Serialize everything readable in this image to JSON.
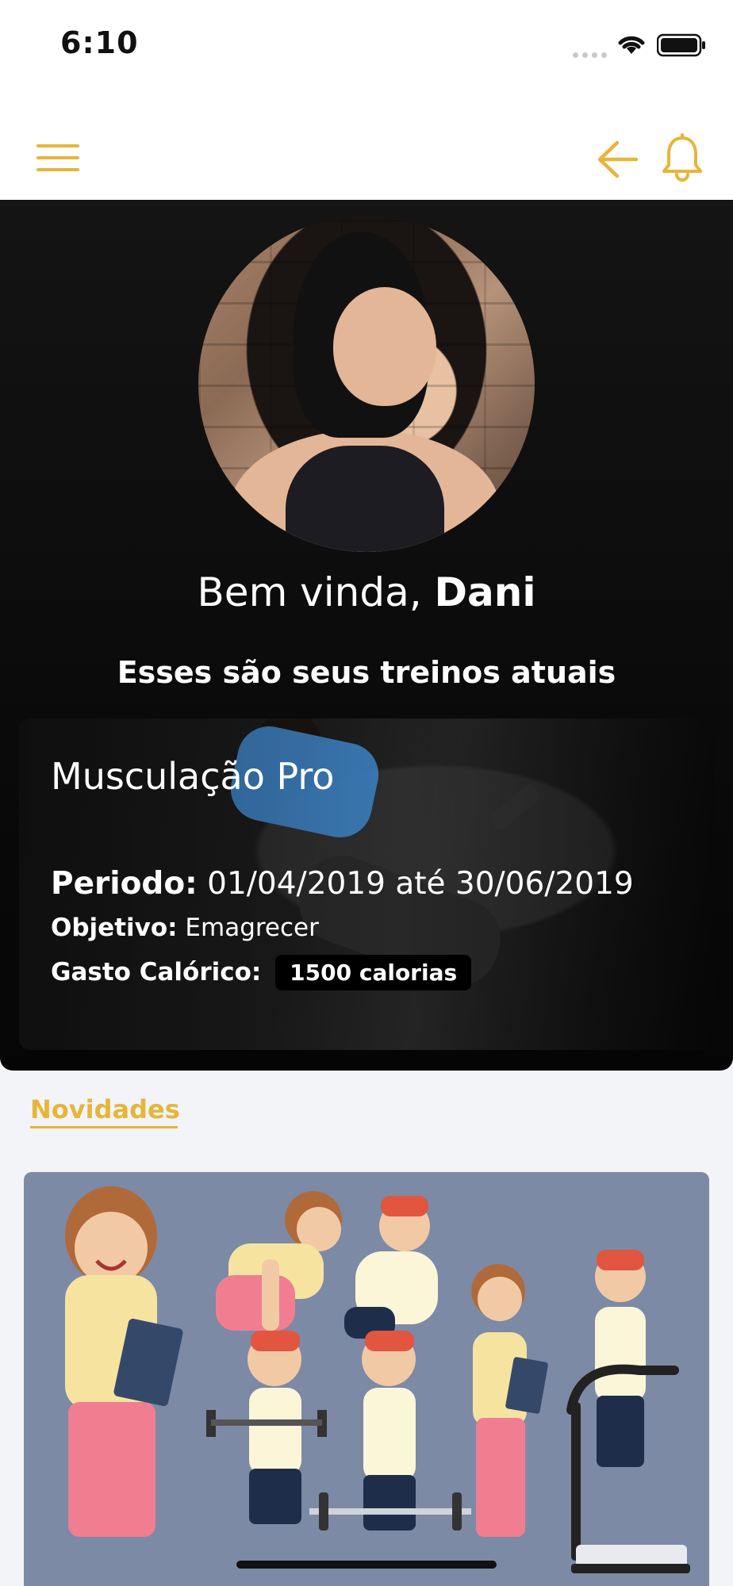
{
  "status_bar": {
    "time": "6:10",
    "icons": [
      "cellular-dots-icon",
      "wifi-icon",
      "battery-icon"
    ]
  },
  "header": {
    "icons": [
      "menu-icon",
      "back-arrow-icon",
      "bell-icon"
    ],
    "accent_color": "#E6B53A"
  },
  "hero": {
    "greeting": "Bem vinda,",
    "user_name": "Dani",
    "subtitle": "Esses são seus treinos atuais"
  },
  "workout_card": {
    "title": "Musculação Pro",
    "period_label": "Periodo:",
    "period_value": "01/04/2019 até 30/06/2019",
    "goal_label": "Objetivo:",
    "goal_value": "Emagrecer",
    "calories_label": "Gasto Calórico:",
    "calories_value": "1500 calorias"
  },
  "news": {
    "title": "Novidades"
  }
}
